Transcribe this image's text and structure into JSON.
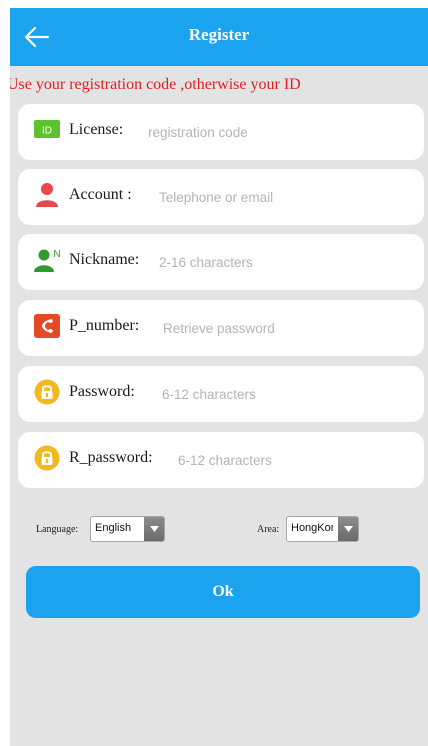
{
  "header": {
    "title": "Register",
    "back_icon": "arrow-left-icon"
  },
  "notice": "Use your registration code ,otherwise your ID",
  "fields": [
    {
      "key": "license",
      "icon": "id-card-icon",
      "label": "License:",
      "placeholder": "registration code",
      "value": ""
    },
    {
      "key": "account",
      "icon": "person-icon",
      "label": "Account :",
      "placeholder": "Telephone or email",
      "value": ""
    },
    {
      "key": "nickname",
      "icon": "user-name-icon",
      "label": "Nickname:",
      "placeholder": "2-16 characters",
      "value": ""
    },
    {
      "key": "p-number",
      "icon": "phone-icon",
      "label": "P_number:",
      "placeholder": "Retrieve password",
      "value": ""
    },
    {
      "key": "password",
      "icon": "lock-icon",
      "label": "Password:",
      "placeholder": "6-12 characters",
      "value": ""
    },
    {
      "key": "r-password",
      "icon": "lock-icon",
      "label": "R_password:",
      "placeholder": "6-12 characters",
      "value": ""
    }
  ],
  "options": {
    "language_label": "Language:",
    "language_value": "English",
    "area_label": "Area:",
    "area_value": "HongKong"
  },
  "ok_label": "Ok",
  "colors": {
    "accent": "#1ba3ef",
    "notice": "#e0211f",
    "background": "#e3e3e3",
    "id_icon": "#5bc42c",
    "person_icon": "#e8474b",
    "nickname_icon": "#2e9b2e",
    "phone_icon": "#e34a26",
    "lock_icon": "#f2b81f"
  }
}
